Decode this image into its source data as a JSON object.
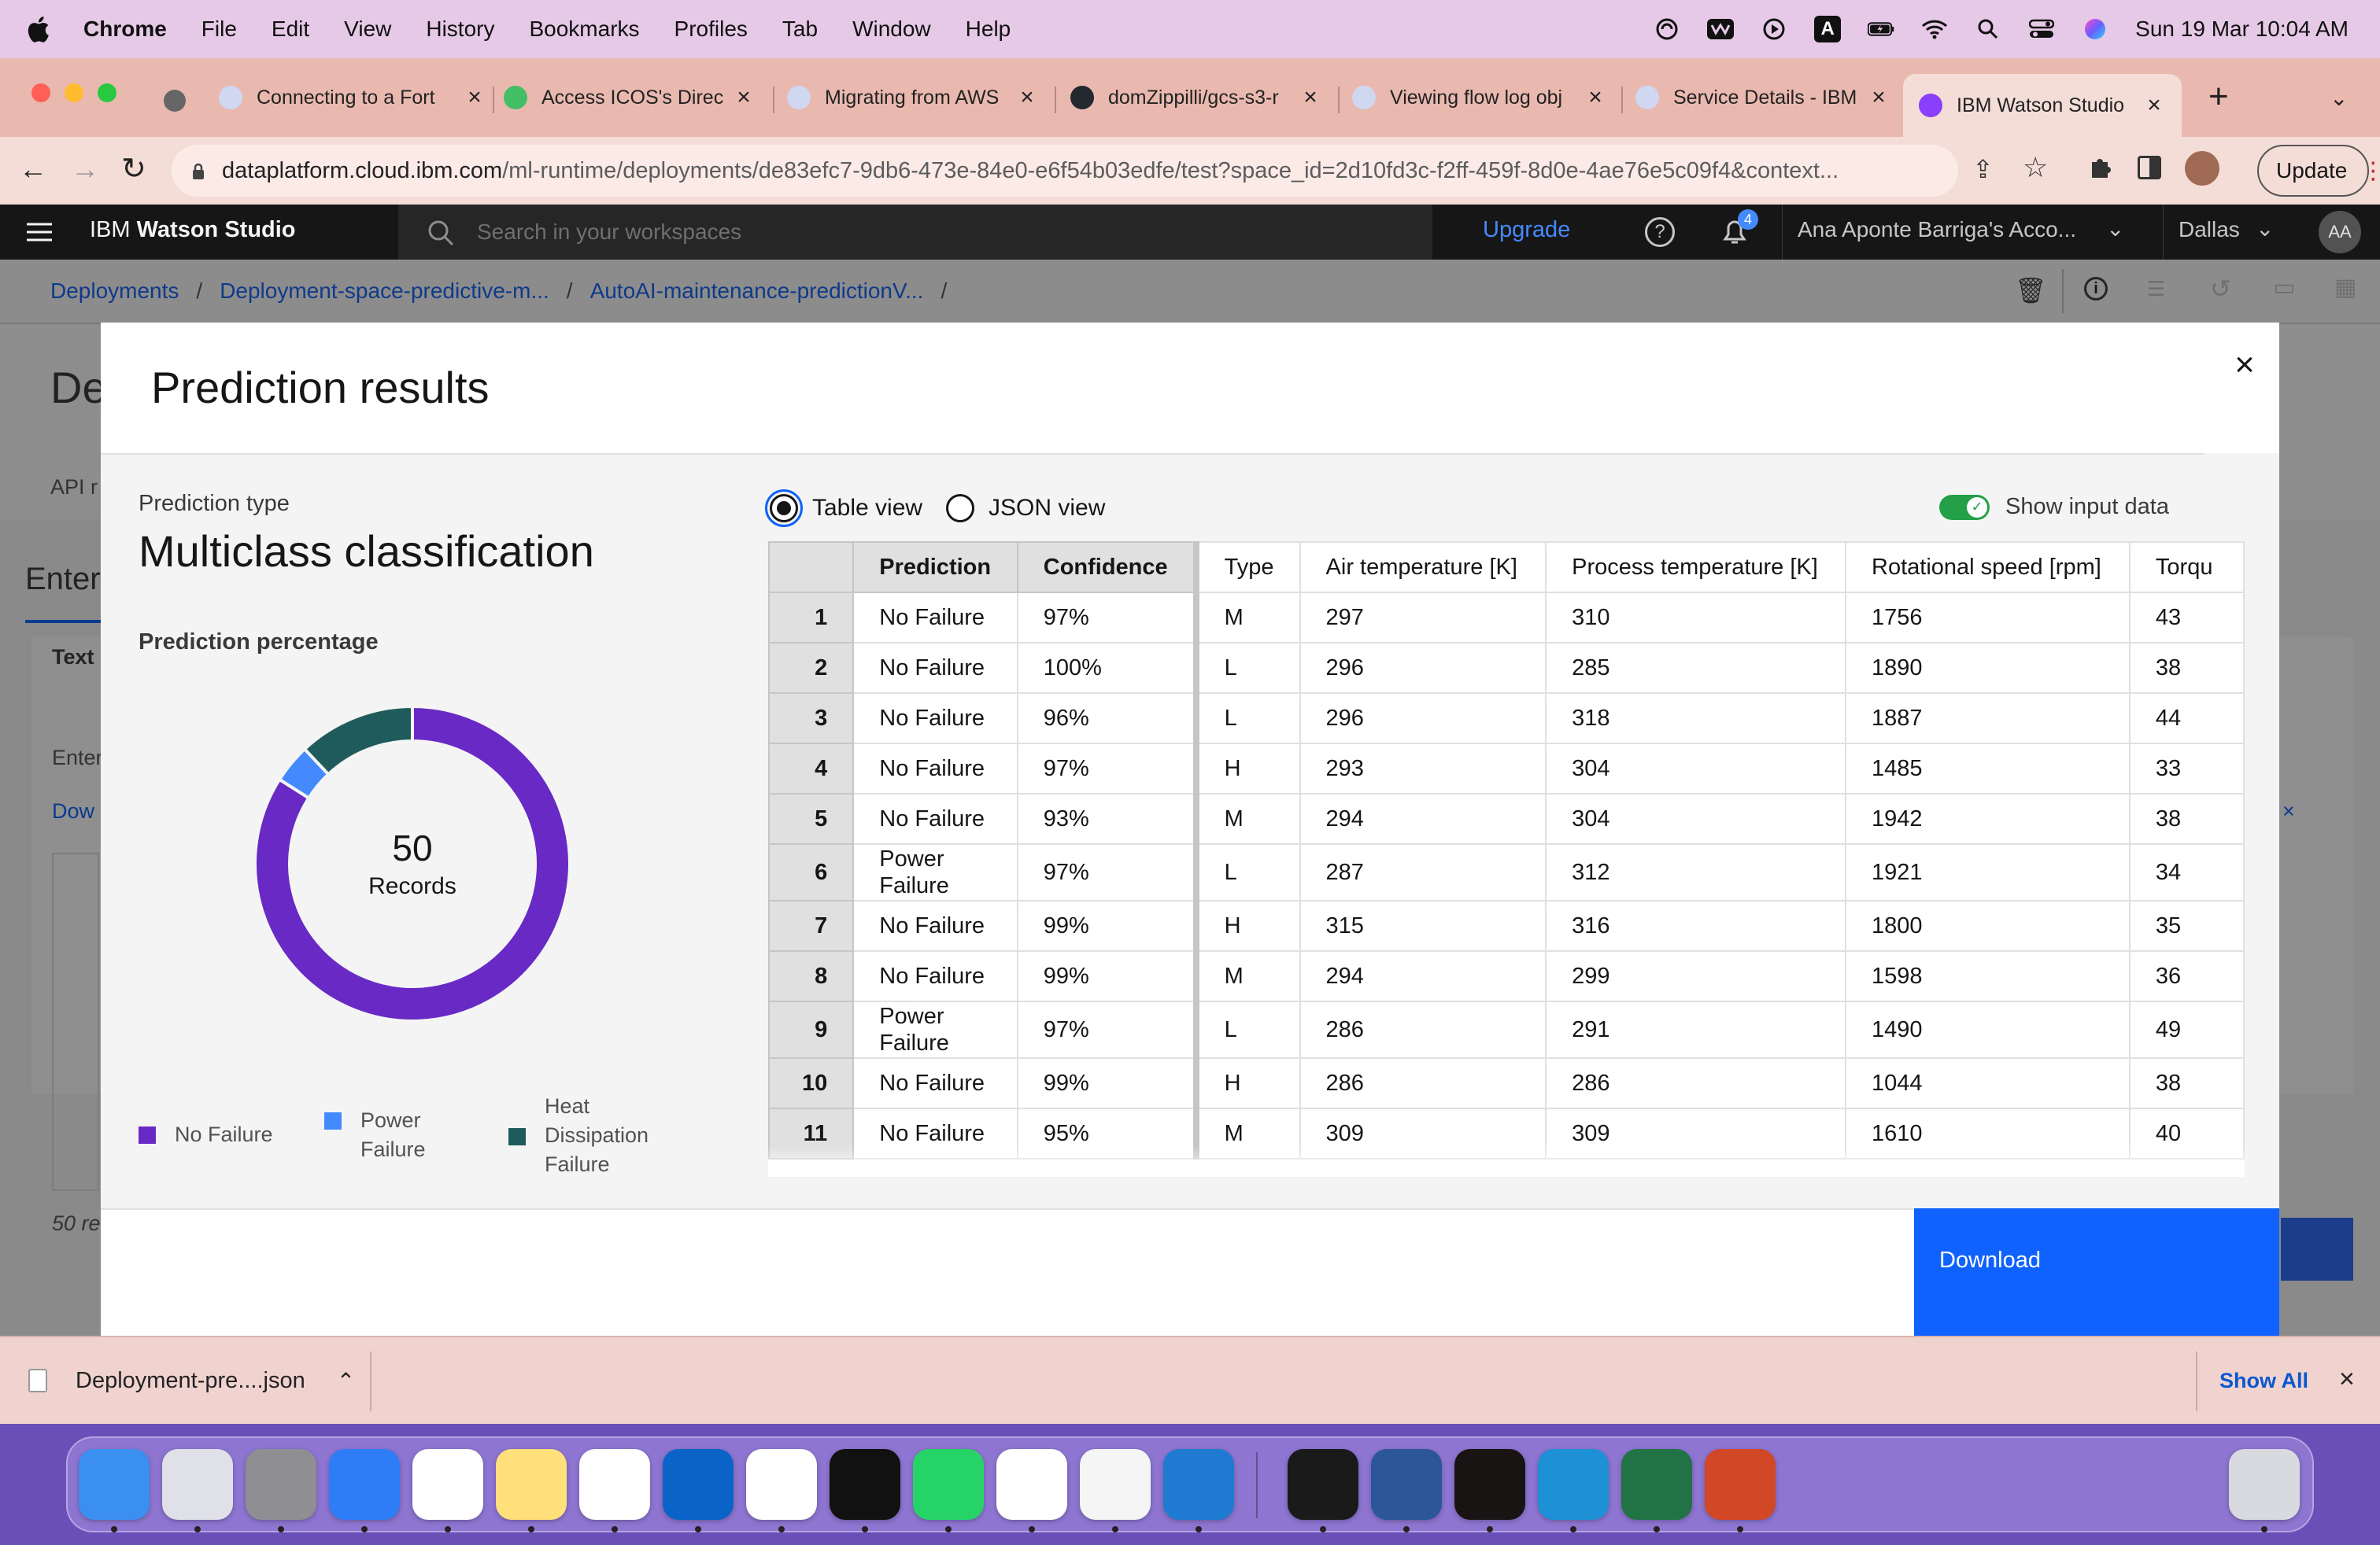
{
  "menubar": {
    "app": "Chrome",
    "items": [
      "File",
      "Edit",
      "View",
      "History",
      "Bookmarks",
      "Profiles",
      "Tab",
      "Window",
      "Help"
    ],
    "clock": "Sun 19 Mar  10:04 AM",
    "input_indicator": "A"
  },
  "browser": {
    "tabs": [
      {
        "title": "Connecting to a Fort",
        "color": "#cfd8f0"
      },
      {
        "title": "Access ICOS's Direc",
        "color": "#42be65"
      },
      {
        "title": "Migrating from AWS",
        "color": "#cfd8f0"
      },
      {
        "title": "domZippilli/gcs-s3-r",
        "color": "#24292f"
      },
      {
        "title": "Viewing flow log obj",
        "color": "#cfd8f0"
      },
      {
        "title": "Service Details - IBM",
        "color": "#cfd8f0"
      },
      {
        "title": "IBM Watson Studio",
        "color": "#8a3ffc"
      }
    ],
    "new_tab": "+",
    "url_host": "dataplatform.cloud.ibm.com",
    "url_path": "/ml-runtime/deployments/de83efc7-9db6-473e-84e0-e6f54b03edfe/test?space_id=2d10fd3c-f2ff-459f-8d0e-4ae76e5c09f4&context...",
    "update_label": "Update"
  },
  "watson": {
    "brand_prefix": "IBM",
    "brand": "Watson Studio",
    "search_placeholder": "Search in your workspaces",
    "upgrade": "Upgrade",
    "notifications": "4",
    "account": "Ana Aponte Barriga's Acco...",
    "region": "Dallas",
    "avatar": "AA"
  },
  "breadcrumbs": [
    "Deployments",
    "Deployment-space-predictive-m...",
    "AutoAI-maintenance-predictionV..."
  ],
  "background_fragments": {
    "title": "De",
    "tab": "API r",
    "enter": "Enter",
    "text": "Text",
    "enter2": "Enter",
    "down": "Dow",
    "records": "50 re"
  },
  "modal": {
    "title": "Prediction results",
    "prediction_type_label": "Prediction type",
    "prediction_type": "Multiclass classification",
    "prediction_pct_label": "Prediction percentage",
    "donut_total": "50",
    "donut_total_label": "Records",
    "table_view": "Table view",
    "json_view": "JSON view",
    "show_input": "Show input data",
    "download": "Download"
  },
  "colors": {
    "no_failure": "#6929c4",
    "power_failure": "#4589ff",
    "heat_dissipation": "#1f5b5a",
    "primary": "#0f62fe"
  },
  "chart_data": {
    "type": "pie",
    "labels": [
      "No Failure",
      "Power Failure",
      "Heat Dissipation Failure"
    ],
    "values": [
      42,
      2,
      6
    ],
    "colors": [
      "#6929c4",
      "#4589ff",
      "#1f5b5a"
    ]
  },
  "table": {
    "columns": [
      "Prediction",
      "Confidence",
      "Type",
      "Air temperature [K]",
      "Process temperature [K]",
      "Rotational speed [rpm]",
      "Torqu"
    ],
    "rows": [
      [
        "1",
        "No Failure",
        "97%",
        "M",
        "297",
        "310",
        "1756",
        "43"
      ],
      [
        "2",
        "No Failure",
        "100%",
        "L",
        "296",
        "285",
        "1890",
        "38"
      ],
      [
        "3",
        "No Failure",
        "96%",
        "L",
        "296",
        "318",
        "1887",
        "44"
      ],
      [
        "4",
        "No Failure",
        "97%",
        "H",
        "293",
        "304",
        "1485",
        "33"
      ],
      [
        "5",
        "No Failure",
        "93%",
        "M",
        "294",
        "304",
        "1942",
        "38"
      ],
      [
        "6",
        "Power Failure",
        "97%",
        "L",
        "287",
        "312",
        "1921",
        "34"
      ],
      [
        "7",
        "No Failure",
        "99%",
        "H",
        "315",
        "316",
        "1800",
        "35"
      ],
      [
        "8",
        "No Failure",
        "99%",
        "M",
        "294",
        "299",
        "1598",
        "36"
      ],
      [
        "9",
        "Power Failure",
        "97%",
        "L",
        "286",
        "291",
        "1490",
        "49"
      ],
      [
        "10",
        "No Failure",
        "99%",
        "H",
        "286",
        "286",
        "1044",
        "38"
      ],
      [
        "11",
        "No Failure",
        "95%",
        "M",
        "309",
        "309",
        "1610",
        "40"
      ]
    ]
  },
  "downloads": {
    "file": "Deployment-pre....json",
    "show_all": "Show All"
  },
  "dock": [
    "Finder",
    "Launchpad",
    "System Settings",
    "Safari",
    "Reminders",
    "Notes",
    "Slack",
    "Outlook",
    "Activity",
    "Terminal",
    "WhatsApp",
    "Chrome",
    "TextEdit",
    "VS Code",
    "Webex",
    "Word",
    "Spotify",
    "Edge",
    "Excel",
    "PowerPoint",
    "Trash"
  ]
}
